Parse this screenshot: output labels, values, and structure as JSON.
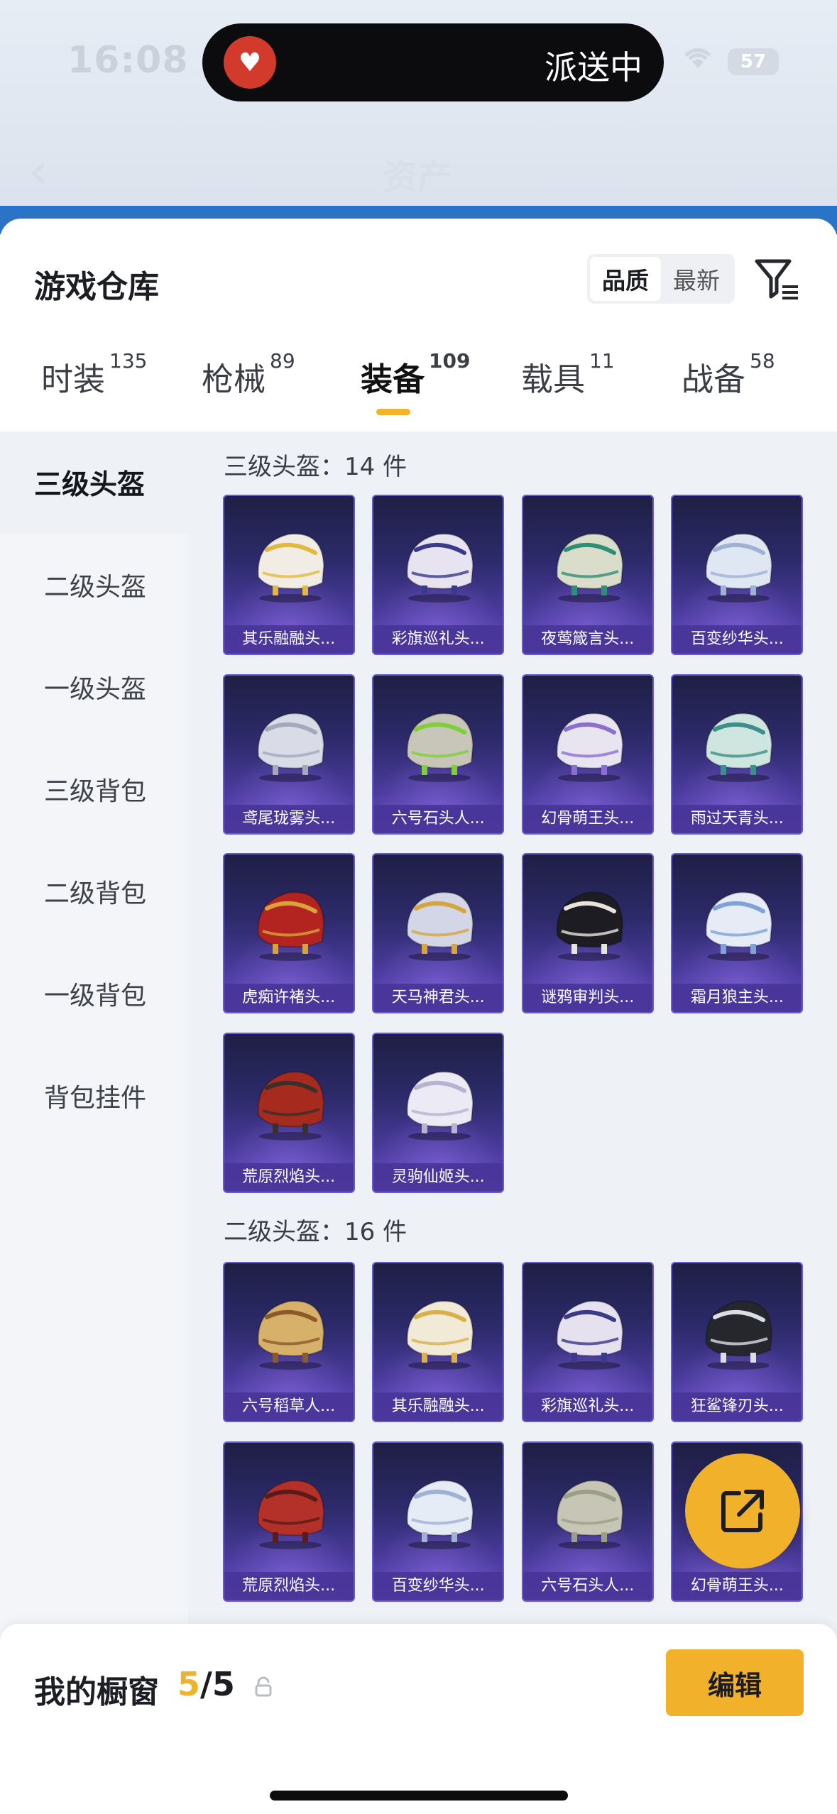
{
  "status_bar": {
    "time": "16:08",
    "island_label": "派送中",
    "battery": "57"
  },
  "nav": {
    "title": "资产"
  },
  "header": {
    "title": "游戏仓库",
    "sort_options": [
      "品质",
      "最新"
    ],
    "active_sort": "品质"
  },
  "tabs": [
    {
      "label": "时装",
      "count": "135"
    },
    {
      "label": "枪械",
      "count": "89"
    },
    {
      "label": "装备",
      "count": "109"
    },
    {
      "label": "载具",
      "count": "11"
    },
    {
      "label": "战备",
      "count": "58"
    }
  ],
  "sidebar": {
    "items": [
      "三级头盔",
      "二级头盔",
      "一级头盔",
      "三级背包",
      "二级背包",
      "一级背包",
      "背包挂件"
    ]
  },
  "groups": [
    {
      "title": "三级头盔：14 件",
      "items": [
        {
          "name": "其乐融融头...",
          "color": "#f1ede4",
          "accent": "#e2b940"
        },
        {
          "name": "彩旗巡礼头...",
          "color": "#e7e3f1",
          "accent": "#3b3a8a"
        },
        {
          "name": "夜莺箴言头...",
          "color": "#d9ddc9",
          "accent": "#2f8f76"
        },
        {
          "name": "百变纱华头...",
          "color": "#dfe7f2",
          "accent": "#9fb2d4"
        },
        {
          "name": "鸢尾珑雾头...",
          "color": "#d9dce6",
          "accent": "#a5a9bb"
        },
        {
          "name": "六号石头人...",
          "color": "#c8c6b8",
          "accent": "#7fcf3a"
        },
        {
          "name": "幻骨萌王头...",
          "color": "#e8e4f0",
          "accent": "#8b6fd0"
        },
        {
          "name": "雨过天青头...",
          "color": "#cfe5df",
          "accent": "#3c8f8a"
        },
        {
          "name": "虎痴许褚头...",
          "color": "#b3231f",
          "accent": "#d9a33a"
        },
        {
          "name": "天马神君头...",
          "color": "#d3d6e6",
          "accent": "#d5a640"
        },
        {
          "name": "谜鸦审判头...",
          "color": "#1d1c22",
          "accent": "#e8e4dc"
        },
        {
          "name": "霜月狼主头...",
          "color": "#e6ebf5",
          "accent": "#7fa2d8"
        },
        {
          "name": "荒原烈焰头...",
          "color": "#a62a1e",
          "accent": "#3a2f2b"
        },
        {
          "name": "灵驹仙姬头...",
          "color": "#eceaf4",
          "accent": "#b7b2d0"
        }
      ]
    },
    {
      "title": "二级头盔：16 件",
      "items": [
        {
          "name": "六号稻草人...",
          "color": "#d7b069",
          "accent": "#8a5a2a"
        },
        {
          "name": "其乐融融头...",
          "color": "#f1ead6",
          "accent": "#d9b14a"
        },
        {
          "name": "彩旗巡礼头...",
          "color": "#e6e1ef",
          "accent": "#3b3a8a"
        },
        {
          "name": "狂鲨锋刃头...",
          "color": "#26272d",
          "accent": "#d9dde6"
        },
        {
          "name": "荒原烈焰头...",
          "color": "#b4312a",
          "accent": "#5a1c18"
        },
        {
          "name": "百变纱华头...",
          "color": "#e6ecf6",
          "accent": "#9fb2d4"
        },
        {
          "name": "六号石头人...",
          "color": "#c7c5b5",
          "accent": "#9aa088"
        },
        {
          "name": "幻骨萌王头...",
          "color": "#e7e3ef",
          "accent": "#8b6fd0"
        }
      ]
    }
  ],
  "bottom": {
    "showcase_label": "我的橱窗",
    "current": "5",
    "total": "/5",
    "edit_label": "编辑"
  }
}
